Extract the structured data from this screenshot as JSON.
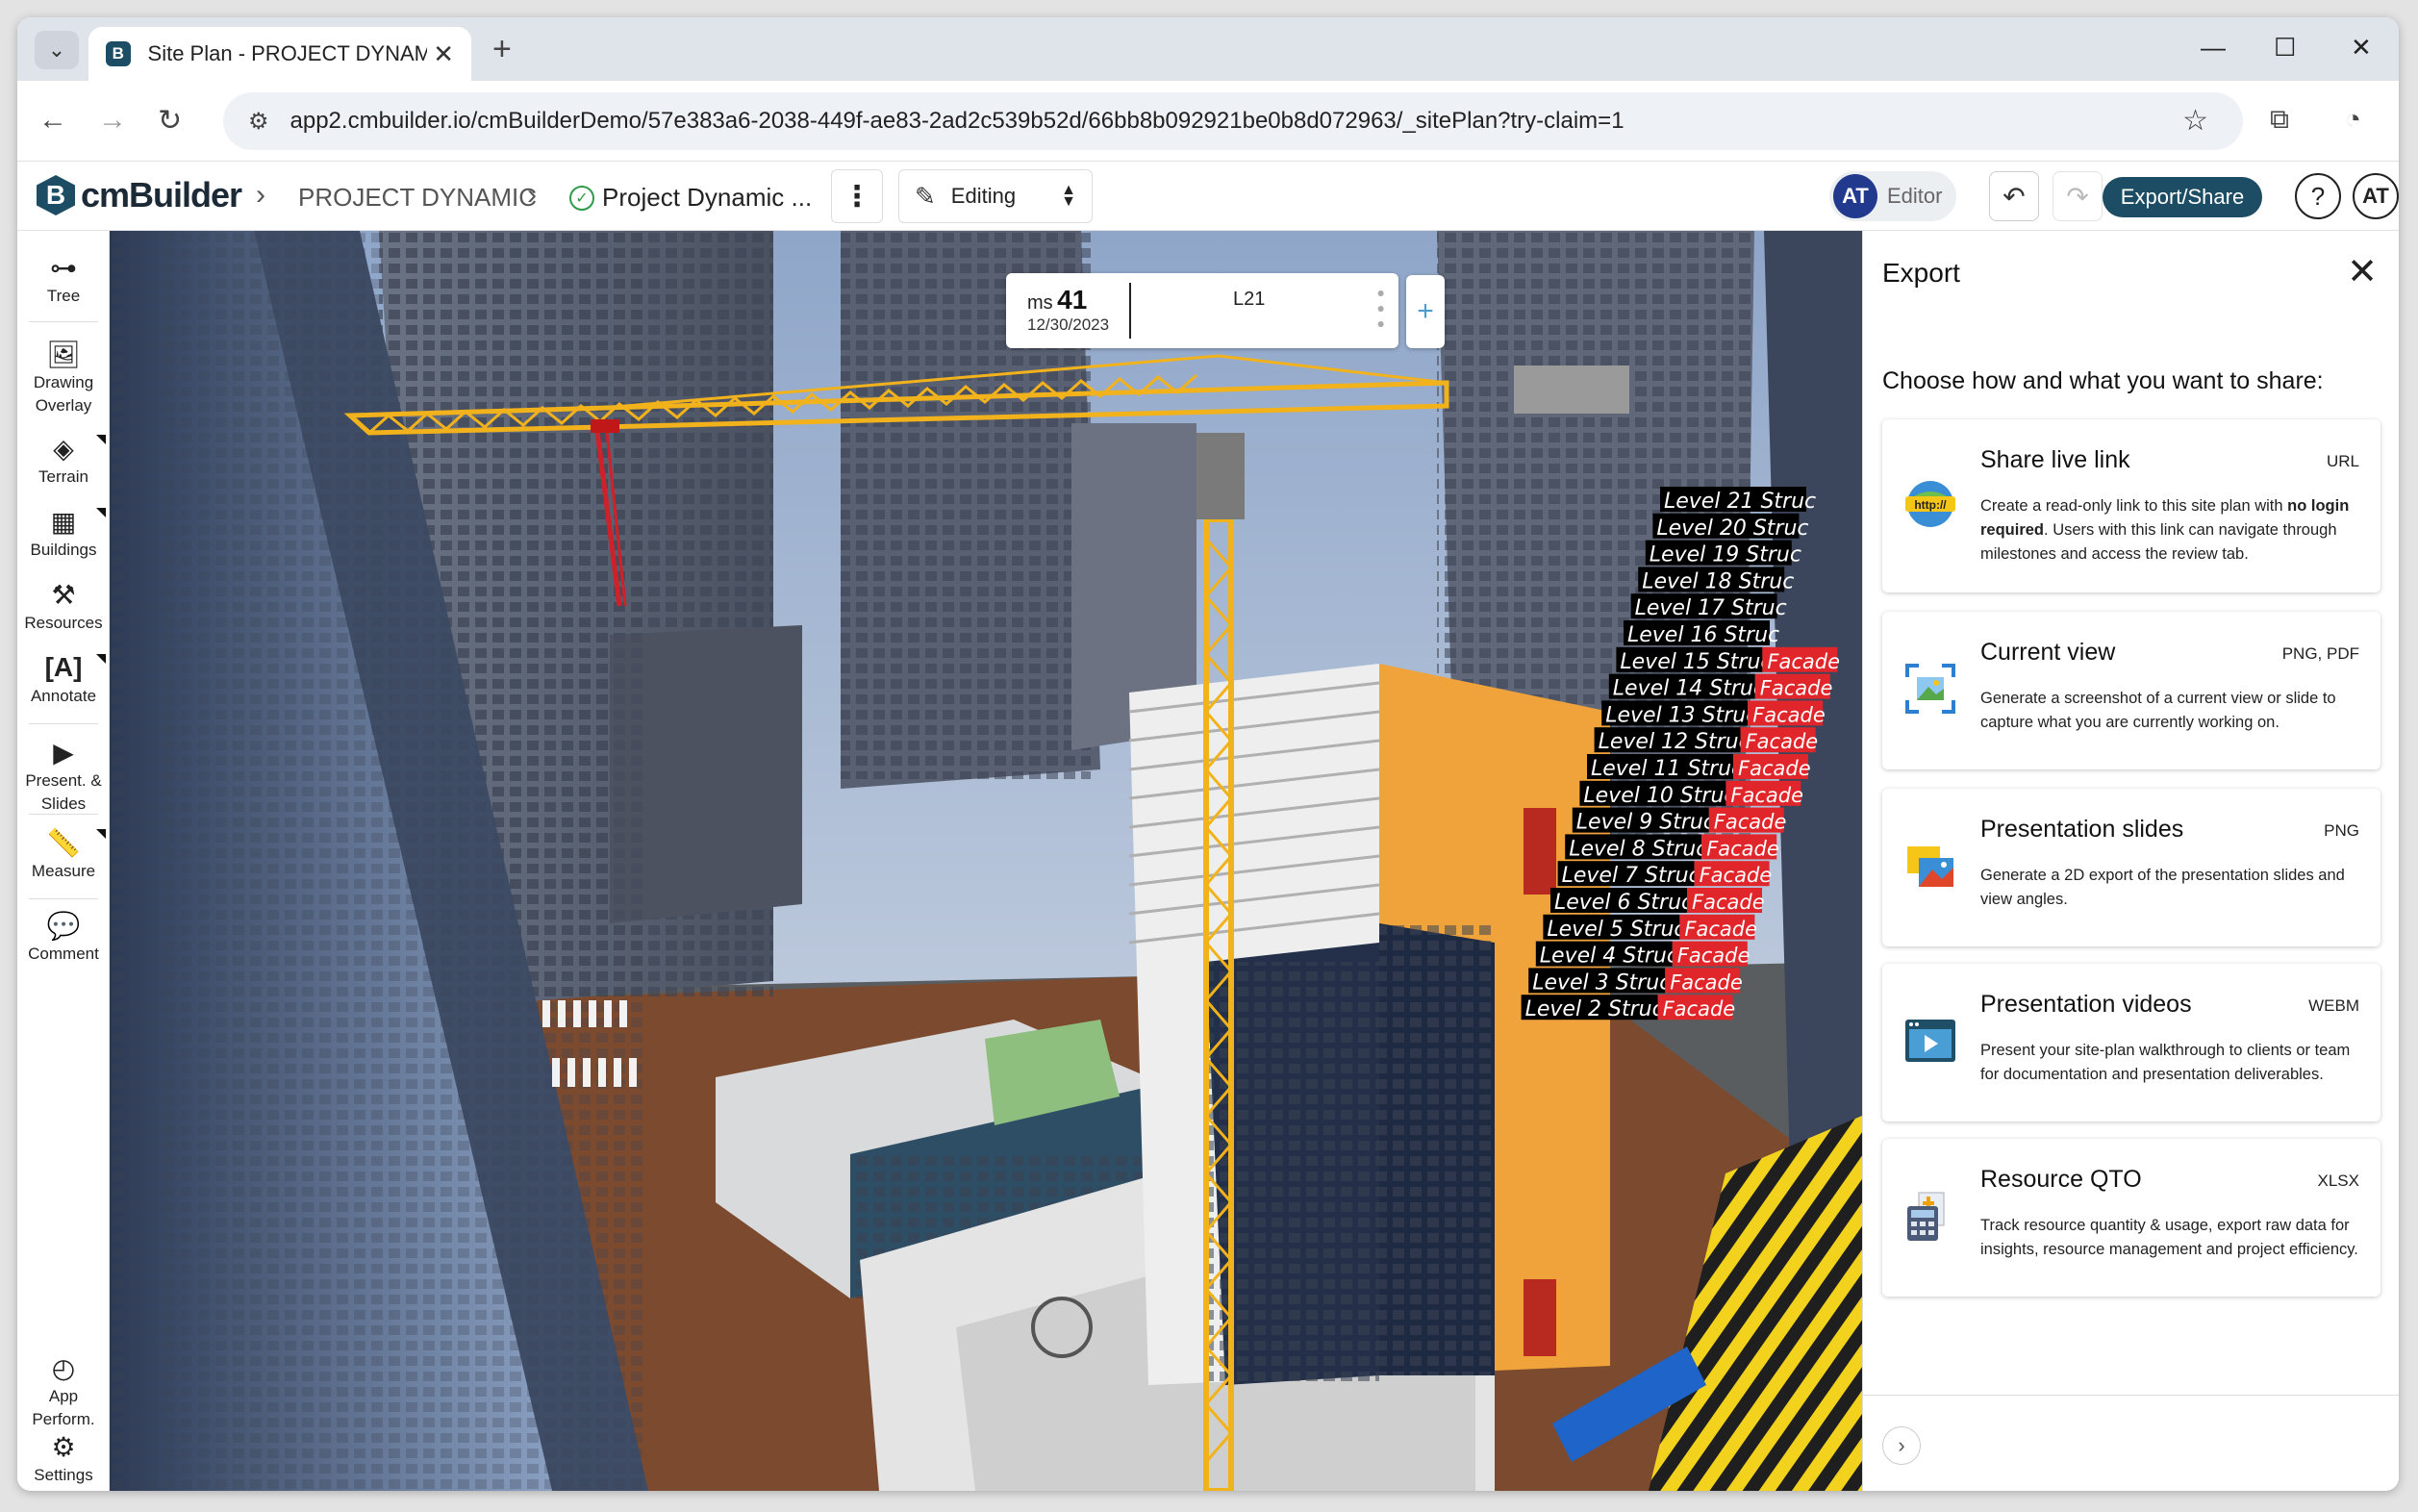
{
  "browser": {
    "tab_title": "Site Plan - PROJECT DYNAMIC |",
    "url": "app2.cmbuilder.io/cmBuilderDemo/57e383a6-2038-449f-ae83-2ad2c539b52d/66bb8b092921be0b8d072963/_sitePlan?try-claim=1"
  },
  "header": {
    "logo_mark": "B",
    "logo_text": "cmBuilder",
    "breadcrumb_project": "PROJECT DYNAMIC",
    "breadcrumb_plan": "Project Dynamic ...",
    "mode": "Editing",
    "user_initials": "AT",
    "user_role": "Editor",
    "export_label": "Export/Share",
    "help_label": "?",
    "profile_initials": "AT"
  },
  "sidebar": {
    "items": [
      {
        "label": "Tree",
        "label2": ""
      },
      {
        "label": "Drawing",
        "label2": "Overlay"
      },
      {
        "label": "Terrain",
        "label2": ""
      },
      {
        "label": "Buildings",
        "label2": ""
      },
      {
        "label": "Resources",
        "label2": ""
      },
      {
        "label": "Annotate",
        "label2": ""
      },
      {
        "label": "Present. &",
        "label2": "Slides"
      },
      {
        "label": "Measure",
        "label2": ""
      },
      {
        "label": "Comment",
        "label2": ""
      },
      {
        "label": "App",
        "label2": "Perform."
      },
      {
        "label": "Settings",
        "label2": ""
      }
    ]
  },
  "milestone": {
    "prefix": "ms",
    "number": "41",
    "date": "12/30/2023",
    "level": "L21",
    "add": "+"
  },
  "scene": {
    "labels": [
      {
        "struc": "Level 21 Struc",
        "facade": ""
      },
      {
        "struc": "Level 20 Struc",
        "facade": ""
      },
      {
        "struc": "Level 19 Struc",
        "facade": ""
      },
      {
        "struc": "Level 18 Struc",
        "facade": ""
      },
      {
        "struc": "Level 17 Struc",
        "facade": ""
      },
      {
        "struc": "Level 16 Struc",
        "facade": ""
      },
      {
        "struc": "Level 15 Struc",
        "facade": "Facade"
      },
      {
        "struc": "Level 14 Struc",
        "facade": "Facade"
      },
      {
        "struc": "Level 13 Struc",
        "facade": "Facade"
      },
      {
        "struc": "Level 12 Struc",
        "facade": "Facade"
      },
      {
        "struc": "Level 11 Struc",
        "facade": "Facade"
      },
      {
        "struc": "Level 10 Struc",
        "facade": "Facade"
      },
      {
        "struc": "Level 9 Struc",
        "facade": "Facade"
      },
      {
        "struc": "Level 8 Struc",
        "facade": "Facade"
      },
      {
        "struc": "Level 7 Struc",
        "facade": "Facade"
      },
      {
        "struc": "Level 6 Struc",
        "facade": "Facade"
      },
      {
        "struc": "Level 5 Struc",
        "facade": "Facade"
      },
      {
        "struc": "Level 4 Struc",
        "facade": "Facade"
      },
      {
        "struc": "Level 3 Struc",
        "facade": "Facade"
      },
      {
        "struc": "Level 2 Struc",
        "facade": "Facade"
      }
    ]
  },
  "panel": {
    "title": "Export",
    "subtitle": "Choose how and what you want to share:",
    "options": [
      {
        "title": "Share live link",
        "format": "URL",
        "desc_pre": "Create a read-only link to this site plan with ",
        "desc_bold": "no login required",
        "desc_post": ". Users with this link can navigate through milestones and access the review tab.",
        "icon_text": "http://"
      },
      {
        "title": "Current view",
        "format": "PNG, PDF",
        "desc": "Generate a screenshot of a current view or slide to capture what you are currently working on."
      },
      {
        "title": "Presentation slides",
        "format": "PNG",
        "desc": "Generate a 2D export of the presentation slides and view angles."
      },
      {
        "title": "Presentation videos",
        "format": "WEBM",
        "desc": "Present your site-plan walkthrough to clients or team for documentation and presentation deliverables."
      },
      {
        "title": "Resource QTO",
        "format": "XLSX",
        "desc": "Track resource quantity & usage, export raw data for insights, resource management and project efficiency."
      }
    ]
  },
  "colors": {
    "brand": "#1d4d64",
    "avatar": "#223a8e",
    "facade_red": "#e0262a",
    "crane_yellow": "#f2b21c"
  }
}
